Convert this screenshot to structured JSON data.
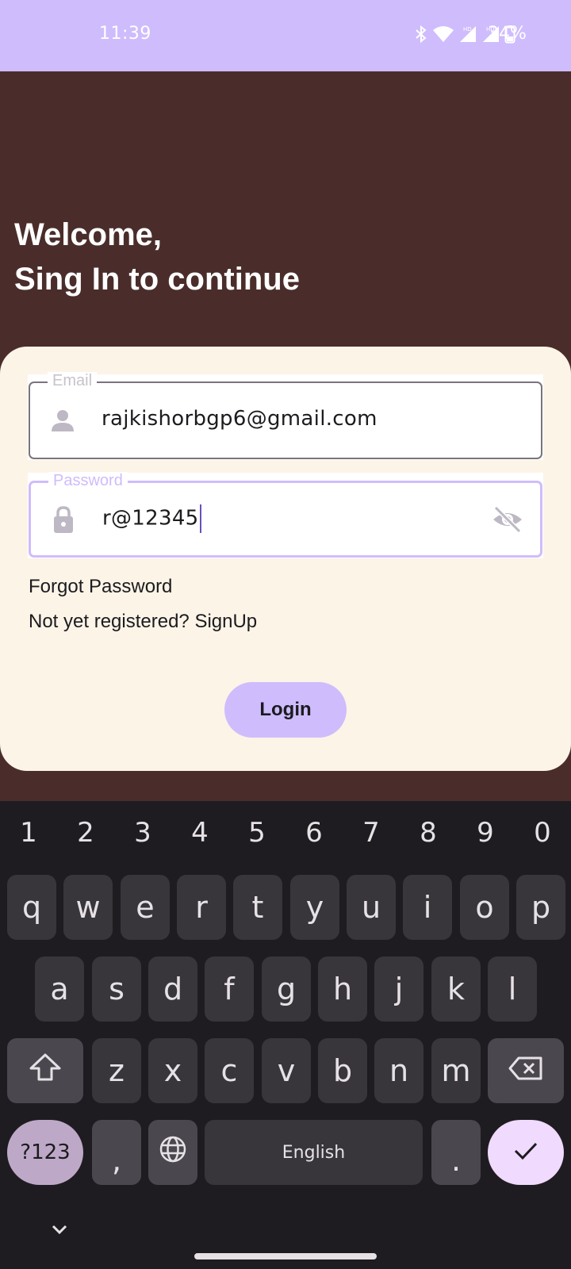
{
  "status_bar": {
    "time": "11:39",
    "battery": "34%"
  },
  "header": {
    "line1": "Welcome,",
    "line2": "Sing In to continue"
  },
  "form": {
    "email": {
      "label": "Email",
      "value": "rajkishorbgp6@gmail.com"
    },
    "password": {
      "label": "Password",
      "value": "r@12345"
    },
    "forgot_password": "Forgot Password",
    "signup_prompt": "Not yet registered? SignUp",
    "login_label": "Login"
  },
  "keyboard": {
    "numbers": [
      "1",
      "2",
      "3",
      "4",
      "5",
      "6",
      "7",
      "8",
      "9",
      "0"
    ],
    "row1": [
      "q",
      "w",
      "e",
      "r",
      "t",
      "y",
      "u",
      "i",
      "o",
      "p"
    ],
    "row2": [
      "a",
      "s",
      "d",
      "f",
      "g",
      "h",
      "j",
      "k",
      "l"
    ],
    "row3": [
      "z",
      "x",
      "c",
      "v",
      "b",
      "n",
      "m"
    ],
    "symbols_label": "?123",
    "comma": ",",
    "space_label": "English",
    "period": "."
  },
  "colors": {
    "accent": "#cfbcfd",
    "background": "#4a2d2a",
    "card": "#fcf4e7",
    "keyboard": "#1e1c20"
  },
  "icons": [
    "bluetooth-icon",
    "wifi-icon",
    "signal-icon",
    "battery-icon",
    "person-icon",
    "lock-icon",
    "eye-off-icon",
    "shift-icon",
    "backspace-icon",
    "globe-icon",
    "check-icon",
    "chevron-down-icon"
  ]
}
